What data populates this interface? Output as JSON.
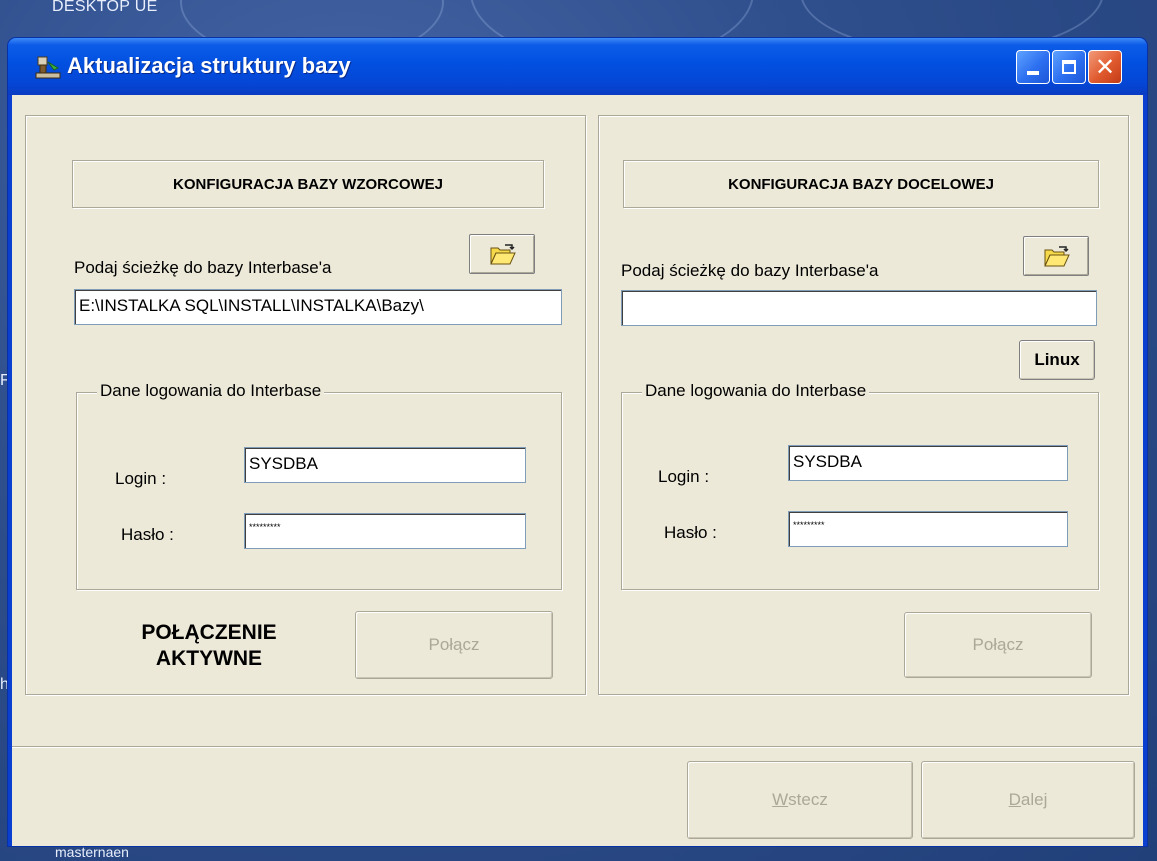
{
  "desktop": {
    "top_label": "DESKTOP UE",
    "bottom_label": "masternaen",
    "edge_left_letters": [
      "F",
      "h"
    ]
  },
  "window": {
    "title": "Aktualizacja struktury bazy",
    "title_icon": "db-tool-icon",
    "controls": {
      "minimize_icon": "minimize-icon",
      "maximize_icon": "maximize-icon",
      "close_icon": "close-icon"
    }
  },
  "left_panel": {
    "header": "KONFIGURACJA BAZY WZORCOWEJ",
    "path_label": "Podaj ścieżkę do bazy Interbase'a",
    "path_value": "E:\\INSTALKA SQL\\INSTALL\\INSTALKA\\Bazy\\",
    "browse_icon": "open-folder-icon",
    "login_group_title": "Dane logowania do Interbase",
    "login_label": "Login :",
    "login_value": "SYSDBA",
    "password_label": "Hasło :",
    "password_value": "*********",
    "status_line1": "POŁĄCZENIE",
    "status_line2": "AKTYWNE",
    "connect_button": "Połącz"
  },
  "right_panel": {
    "header": "KONFIGURACJA BAZY DOCELOWEJ",
    "path_label": "Podaj ścieżkę do bazy Interbase'a",
    "path_value": "",
    "browse_icon": "open-folder-icon",
    "linux_button": "Linux",
    "login_group_title": "Dane logowania do Interbase",
    "login_label": "Login :",
    "login_value": "SYSDBA",
    "password_label": "Hasło :",
    "password_value": "*********",
    "connect_button": "Połącz"
  },
  "footer": {
    "back_button_prefix": "W",
    "back_button_rest": "stecz",
    "next_button_prefix": "D",
    "next_button_rest": "alej"
  },
  "colors": {
    "titlebar": "#0250e0",
    "client_bg": "#ece9d8",
    "disabled_text": "#aca899",
    "close_button": "#e05a2e"
  }
}
